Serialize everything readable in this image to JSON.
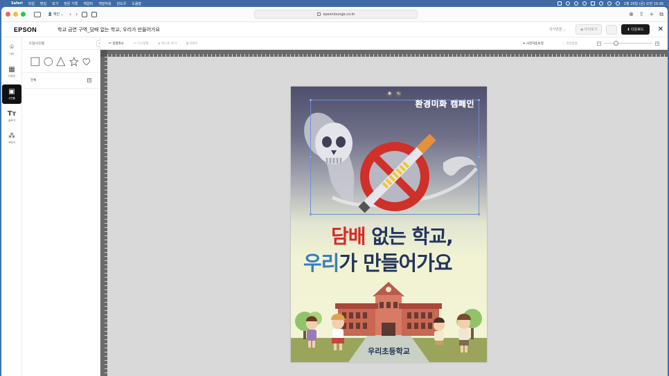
{
  "menubar": {
    "app": "Safari",
    "items": [
      "파일",
      "편집",
      "보기",
      "방문 기록",
      "책갈피",
      "개발자용",
      "윈도우",
      "도움말"
    ],
    "clock": "2월 20일 (금) 오전 10:26"
  },
  "browser": {
    "profile": "개인",
    "url": "epsonlounge.co.kr"
  },
  "app": {
    "logo": "EPSON",
    "doc_title": "학교 금연 구역_담배 없는 학교, 우리가 만들어가요",
    "lang": "국가변경",
    "preview": "미리보기",
    "download": "다운로드"
  },
  "rail": [
    {
      "label": "사진",
      "icon": "camera-icon"
    },
    {
      "label": "디자인",
      "icon": "grid-icon"
    },
    {
      "label": "사진틀",
      "icon": "frame-icon"
    },
    {
      "label": "글쓰기",
      "icon": "text-icon"
    },
    {
      "label": "꾸미기",
      "icon": "shapes-icon"
    }
  ],
  "panel": {
    "title": "도형/사진틀",
    "section": "전체"
  },
  "editor": {
    "undo": "실행취소",
    "redo": "다시실행",
    "bring_front": "맥스로 위기",
    "group": "위로드",
    "auto_enhance": "사진자동보정",
    "fullscreen": "화면맞춤"
  },
  "poster": {
    "campaign": "환경미화 캠페인",
    "line1_red": "담배",
    "line1_rest": " 없는 학교,",
    "line2_blue": "우리",
    "line2_rest": "가 만들어가요",
    "school": "우리초등학교"
  },
  "colors": {
    "accent_red": "#d82a26",
    "accent_blue": "#3a7cc0",
    "navy": "#23345c",
    "selection": "#6d8ed6"
  }
}
